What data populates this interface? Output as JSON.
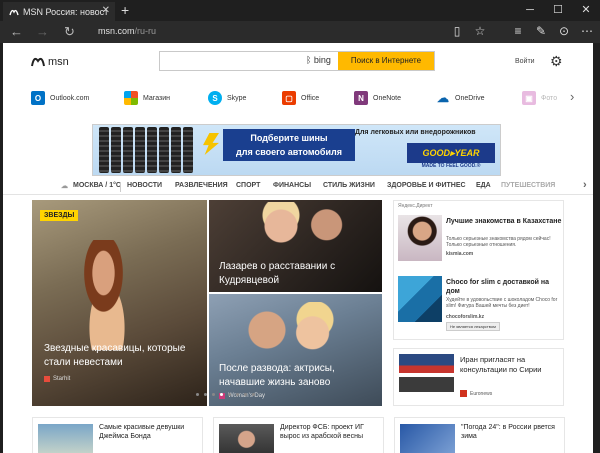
{
  "browser": {
    "tab_title": "MSN Россия: новости, г",
    "url_domain": "msn.com",
    "url_path": "/ru-ru",
    "icons": [
      "back-icon",
      "forward-icon",
      "refresh-icon",
      "reading-view-icon",
      "favorite-star-icon",
      "hub-icon",
      "web-note-icon",
      "share-icon",
      "more-icon"
    ]
  },
  "header": {
    "logo_text": "msn",
    "search_placeholder": "",
    "bing_label": "bing",
    "search_button": "Поиск в Интернете",
    "signin": "Войти"
  },
  "apps": [
    {
      "label": "Outlook.com",
      "color": "#0072c6"
    },
    {
      "label": "Магазин",
      "color": "#f25022"
    },
    {
      "label": "Skype",
      "color": "#00aff0"
    },
    {
      "label": "Office",
      "color": "#eb3c00"
    },
    {
      "label": "OneNote",
      "color": "#80397b"
    },
    {
      "label": "OneDrive",
      "color": "#0a64ad"
    },
    {
      "label": "Фото",
      "color": "#c03fa8"
    }
  ],
  "ad": {
    "slogan_line1": "Подберите шины",
    "slogan_line2": "для своего автомобиля",
    "subtitle": "Для легковых или внедорожников",
    "brand": "GOOD▸YEAR",
    "tagline": "MADE TO FEEL GOOD.®"
  },
  "categories": {
    "weather": "МОСКВА / 1°C",
    "items": [
      "НОВОСТИ",
      "РАЗВЛЕЧЕНИЯ",
      "СПОРТ",
      "ФИНАНСЫ",
      "СТИЛЬ ЖИЗНИ",
      "ЗДОРОВЬЕ И ФИТНЕС",
      "ЕДА",
      "ПУТЕШЕСТВИЯ"
    ]
  },
  "hero": {
    "badge": "ЗВЕЗДЫ",
    "main_caption": "Звездные красавицы, которые стали невестами",
    "main_source": "Starhit",
    "top_right_caption": "Лазарев о расставании с Кудрявцевой",
    "bottom_right_caption": "После развода: актрисы, начавшие жизнь заново",
    "bottom_right_source": "Woman's Day",
    "active_slide": 3,
    "slide_count": 8
  },
  "sidebar": {
    "header": "Яндекс.Директ",
    "items": [
      {
        "title": "Лучшие знакомства в Казахстане",
        "desc": "Только серьезные знакомства рядом сейчас! Только серьезные отношения.",
        "url": "kismia.com"
      },
      {
        "title": "Choco for slim с доставкой на дом",
        "desc": "Худейте в удовольствие с шоколадом Choco for slim! Фигура Вашей мечты без диет!",
        "url": "chocoforslim.kz",
        "badge": "Не является лекарством"
      }
    ]
  },
  "news_right": {
    "title": "Иран пригласят на консультации по Сирии",
    "source": "Euronews"
  },
  "bottom_cards": [
    {
      "title": "Самые красивые девушки Джеймса Бонда"
    },
    {
      "title": "Директор ФСБ: проект ИГ вырос из арабской весны"
    },
    {
      "title": "\"Погода 24\": в России рвется зима"
    }
  ]
}
